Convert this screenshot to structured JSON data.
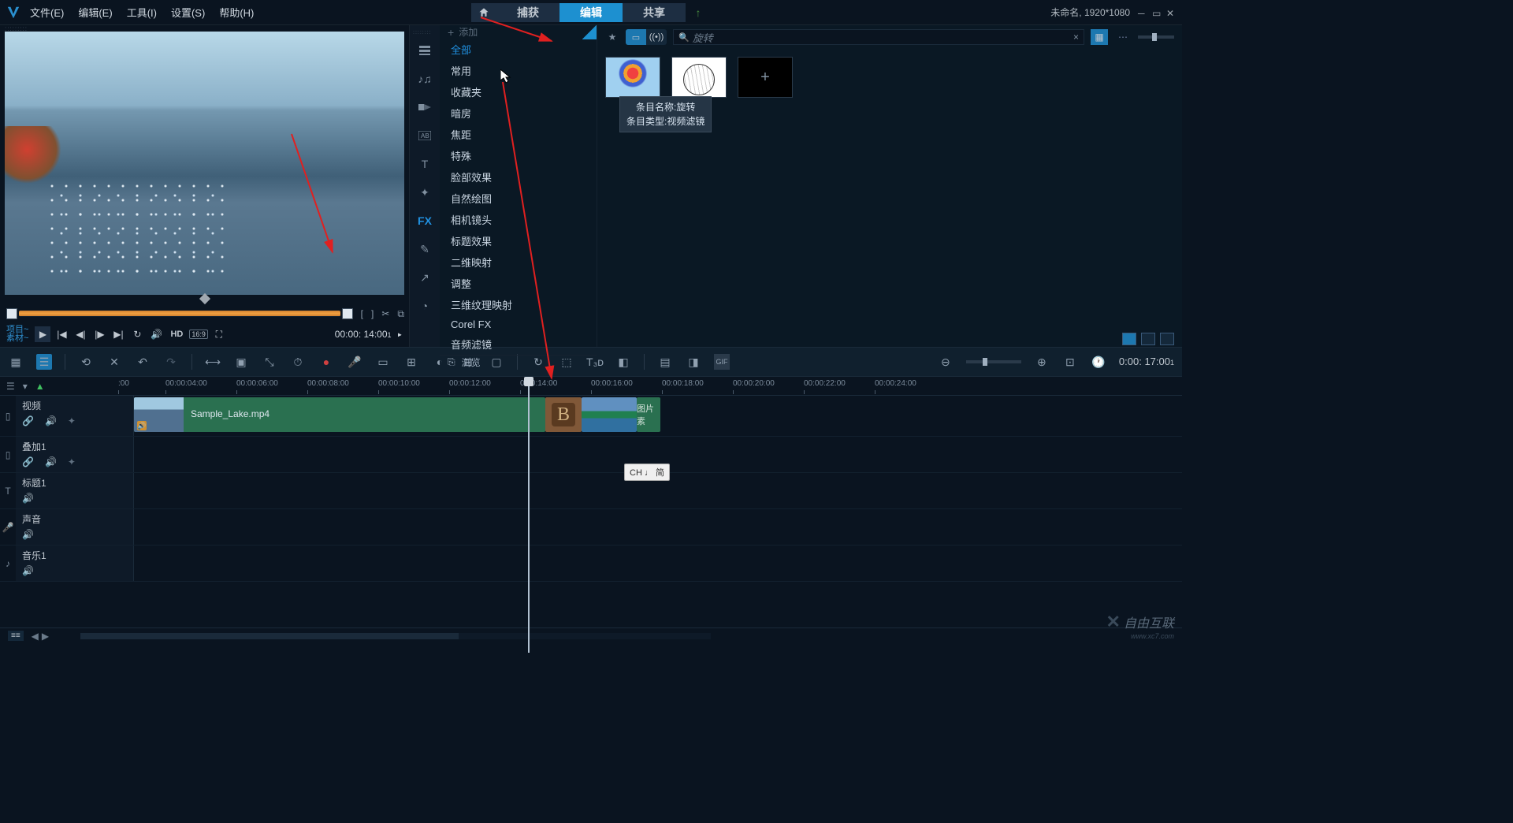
{
  "menu": {
    "file": "文件(E)",
    "edit": "编辑(E)",
    "tools": "工具(I)",
    "settings": "设置(S)",
    "help": "帮助(H)"
  },
  "tabs": {
    "capture": "捕获",
    "edit": "编辑",
    "share": "共享"
  },
  "project": {
    "title": "未命名",
    "resolution": "1920*1080"
  },
  "preview": {
    "mode_top": "项目~",
    "mode_bottom": "素材~",
    "hd": "HD",
    "aspect": "16:9",
    "timecode": "00:00: 14:00",
    "timecode_frames": "1"
  },
  "library": {
    "add": "添加",
    "categories": [
      "全部",
      "常用",
      "收藏夹",
      "暗房",
      "焦距",
      "特殊",
      "脸部效果",
      "自然绘图",
      "相机镜头",
      "标题效果",
      "二维映射",
      "调整",
      "三维纹理映射",
      "Corel FX",
      "音频滤镜"
    ],
    "browse": "浏览",
    "search_text": "旋转",
    "thumbs": {
      "rotate": "旋",
      "add": ""
    },
    "tooltip": {
      "line1": "条目名称:旋转",
      "line2": "条目类型:视频滤镜"
    }
  },
  "toolbar": {
    "timecode": "0:00: 17:00",
    "timecode_frames": "1"
  },
  "timeline": {
    "ticks": [
      ":00",
      "00:00:04:00",
      "00:00:06:00",
      "00:00:08:00",
      "00:00:10:00",
      "00:00:12:00",
      "0:00:14:00",
      "00:00:16:00",
      "00:00:18:00",
      "00:00:20:00",
      "00:00:22:00",
      "00:00:24:00"
    ],
    "tracks": {
      "video": "视频",
      "overlay": "叠加1",
      "title": "标题1",
      "voice": "声音",
      "music": "音乐1"
    },
    "clip_video": "Sample_Lake.mp4",
    "clip_imglabel": "图片素"
  },
  "ime": "CH ♩ 简",
  "watermark": {
    "main": "自由互联",
    "sub": "www.xc7.com"
  }
}
